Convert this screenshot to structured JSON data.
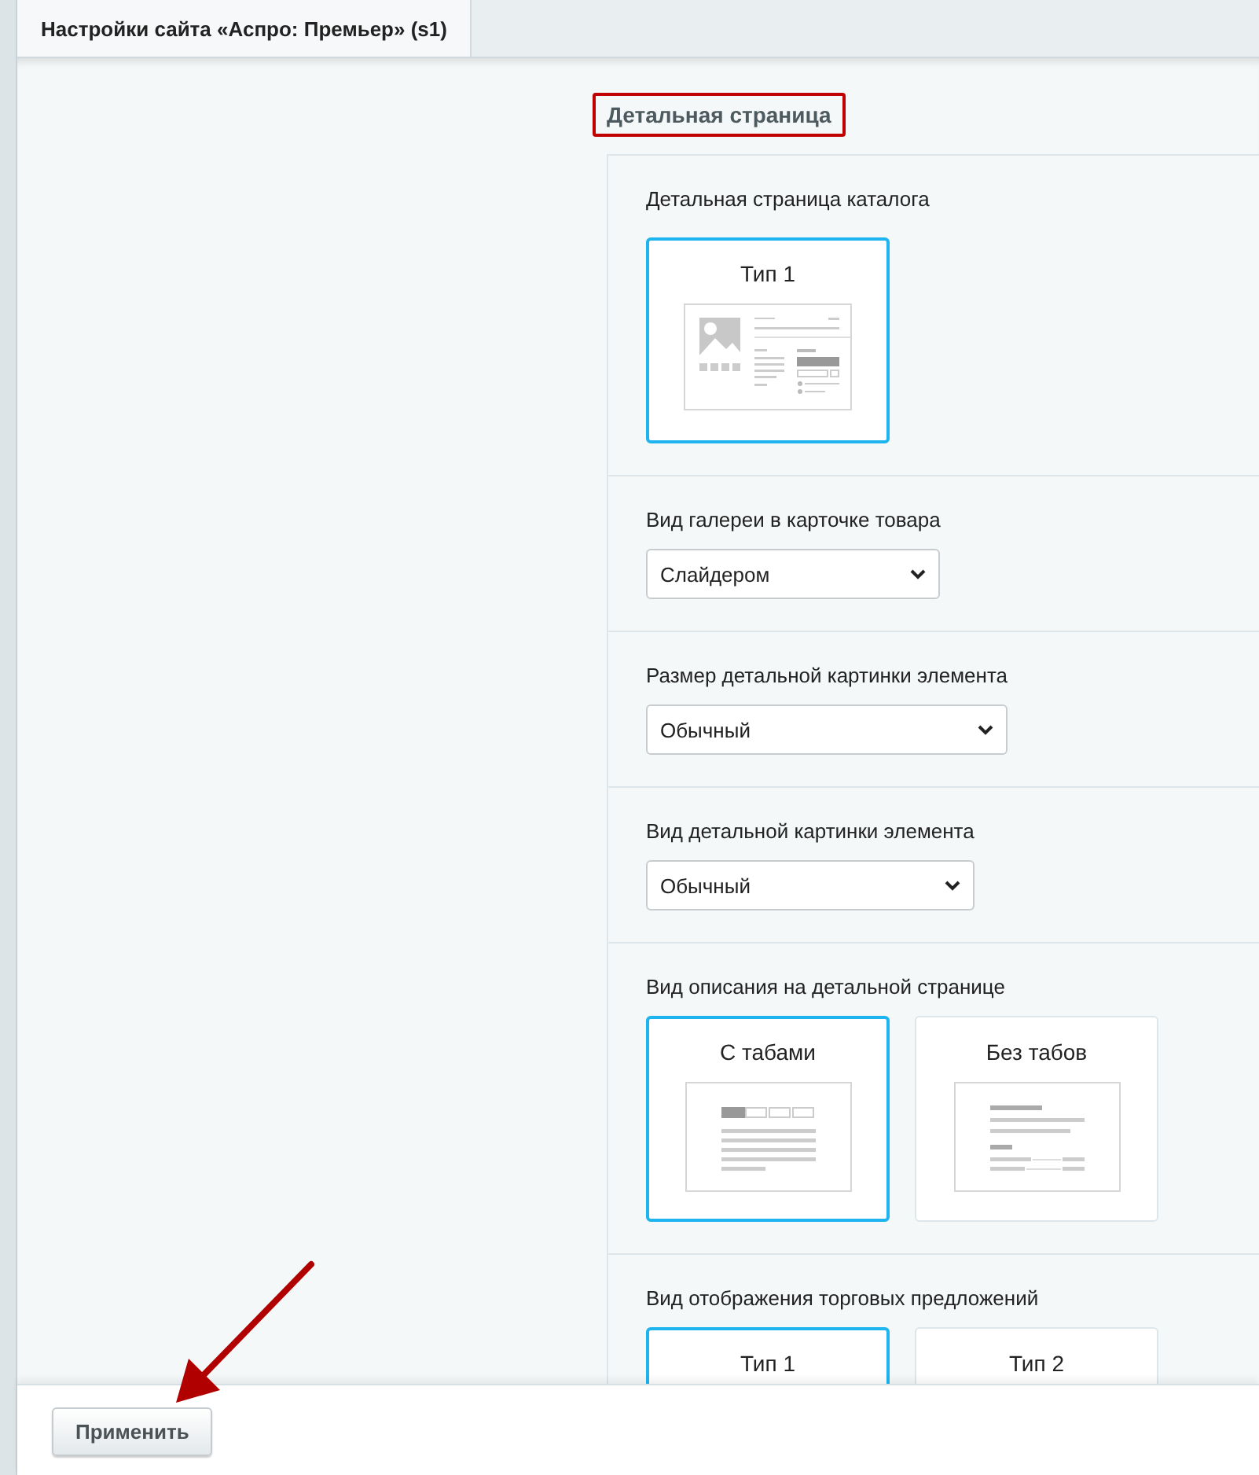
{
  "tabs": [
    {
      "label": "Настройки сайта «Аспро: Премьер» (s1)",
      "selected": true
    }
  ],
  "section_title": "Детальная страница",
  "settings": [
    {
      "kind": "options",
      "label": "Детальная страница каталога",
      "options": [
        {
          "label": "Тип 1",
          "selected": true,
          "kind": "catalog"
        }
      ]
    },
    {
      "kind": "select",
      "label": "Вид галереи в карточке товара",
      "value": "Слайдером"
    },
    {
      "kind": "select",
      "label": "Размер детальной картинки элемента",
      "value": "Обычный"
    },
    {
      "kind": "select",
      "label": "Вид детальной картинки элемента",
      "value": "Обычный"
    },
    {
      "kind": "options",
      "label": "Вид описания на детальной странице",
      "options": [
        {
          "label": "С табами",
          "selected": true,
          "kind": "tabs"
        },
        {
          "label": "Без табов",
          "selected": false,
          "kind": "notabs"
        }
      ]
    },
    {
      "kind": "options",
      "label": "Вид отображения торговых предложений",
      "options": [
        {
          "label": "Тип 1",
          "selected": true,
          "kind": "none"
        },
        {
          "label": "Тип 2",
          "selected": false,
          "kind": "none"
        }
      ]
    }
  ],
  "apply_button": "Применить"
}
